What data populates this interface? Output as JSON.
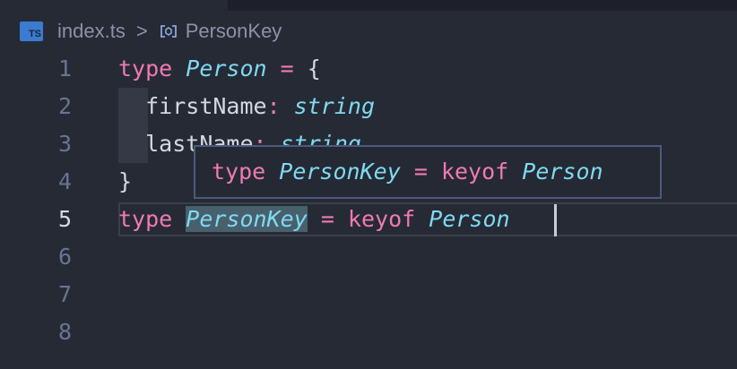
{
  "breadcrumb": {
    "file_icon_label": "TS",
    "file_name": "index.ts",
    "separator": ">",
    "symbol": "PersonKey"
  },
  "line_numbers": [
    "1",
    "2",
    "3",
    "4",
    "5",
    "6",
    "7",
    "8"
  ],
  "active_line": "5",
  "code": {
    "line1": {
      "kw": "type",
      "name": "Person",
      "op": "=",
      "brace": "{"
    },
    "line2": {
      "prop": "firstName",
      "colon": ":",
      "type": "string"
    },
    "line3": {
      "prop": "lastName",
      "colon": ":",
      "type": "string"
    },
    "line4": {
      "brace": "}"
    },
    "line5": {
      "kw": "type",
      "name": "PersonKey",
      "op": "=",
      "kw2": "keyof",
      "ref": "Person"
    }
  },
  "hover": {
    "kw": "type",
    "name": "PersonKey",
    "op": "=",
    "kw2": "keyof",
    "ref": "Person"
  },
  "colors": {
    "background": "#262a35",
    "keyword": "#f07ab4",
    "type": "#7fdaf2",
    "text": "#d4d8e2",
    "line_number": "#6a7490",
    "ts_icon": "#3b7bd1"
  }
}
